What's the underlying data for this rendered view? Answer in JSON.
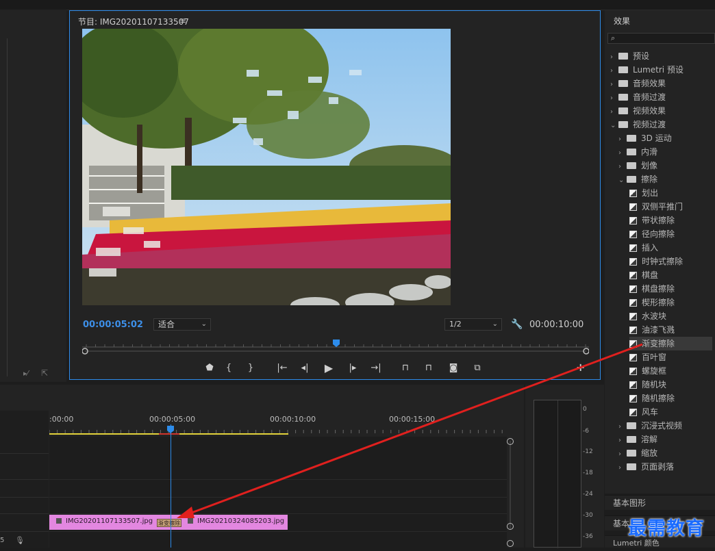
{
  "program_monitor": {
    "title": "节目: IMG20201107133507",
    "menu_icon": "≡",
    "timecode_current": "00:00:05:02",
    "fit_label": "适合",
    "resolution_label": "1/2",
    "timecode_duration": "00:00:10:00"
  },
  "transport": {
    "buttons": [
      "marker-icon",
      "mark-in-icon",
      "mark-out-icon",
      "go-to-in-icon",
      "step-back-icon",
      "play-icon",
      "step-forward-icon",
      "go-to-out-icon",
      "lift-icon",
      "extract-icon",
      "camera-icon",
      "compare-icon",
      "add-icon"
    ]
  },
  "effects": {
    "title": "效果",
    "tree": [
      {
        "label": "预设",
        "type": "folder",
        "level": 0,
        "arrow": "›"
      },
      {
        "label": "Lumetri 预设",
        "type": "folder",
        "level": 0,
        "arrow": "›"
      },
      {
        "label": "音频效果",
        "type": "folder",
        "level": 0,
        "arrow": "›"
      },
      {
        "label": "音频过渡",
        "type": "folder",
        "level": 0,
        "arrow": "›"
      },
      {
        "label": "视频效果",
        "type": "folder",
        "level": 0,
        "arrow": "›"
      },
      {
        "label": "视频过渡",
        "type": "folder",
        "level": 0,
        "arrow": "⌄"
      },
      {
        "label": "3D 运动",
        "type": "folder",
        "level": 1,
        "arrow": "›"
      },
      {
        "label": "内滑",
        "type": "folder",
        "level": 1,
        "arrow": "›"
      },
      {
        "label": "划像",
        "type": "folder",
        "level": 1,
        "arrow": "›"
      },
      {
        "label": "擦除",
        "type": "folder",
        "level": 1,
        "arrow": "⌄"
      },
      {
        "label": "划出",
        "type": "effect",
        "level": 2
      },
      {
        "label": "双侧平推门",
        "type": "effect",
        "level": 2
      },
      {
        "label": "带状擦除",
        "type": "effect",
        "level": 2
      },
      {
        "label": "径向擦除",
        "type": "effect",
        "level": 2
      },
      {
        "label": "插入",
        "type": "effect",
        "level": 2
      },
      {
        "label": "时钟式擦除",
        "type": "effect",
        "level": 2
      },
      {
        "label": "棋盘",
        "type": "effect",
        "level": 2
      },
      {
        "label": "棋盘擦除",
        "type": "effect",
        "level": 2
      },
      {
        "label": "楔形擦除",
        "type": "effect",
        "level": 2
      },
      {
        "label": "水波块",
        "type": "effect",
        "level": 2
      },
      {
        "label": "油漆飞溅",
        "type": "effect",
        "level": 2
      },
      {
        "label": "渐变擦除",
        "type": "effect",
        "level": 2,
        "selected": true
      },
      {
        "label": "百叶窗",
        "type": "effect",
        "level": 2
      },
      {
        "label": "螺旋框",
        "type": "effect",
        "level": 2
      },
      {
        "label": "随机块",
        "type": "effect",
        "level": 2
      },
      {
        "label": "随机擦除",
        "type": "effect",
        "level": 2
      },
      {
        "label": "风车",
        "type": "effect",
        "level": 2
      },
      {
        "label": "沉浸式视频",
        "type": "folder",
        "level": 1,
        "arrow": "›"
      },
      {
        "label": "溶解",
        "type": "folder",
        "level": 1,
        "arrow": "›"
      },
      {
        "label": "缩放",
        "type": "folder",
        "level": 1,
        "arrow": "›"
      },
      {
        "label": "页面剥落",
        "type": "folder",
        "level": 1,
        "arrow": "›"
      }
    ],
    "bottom_tabs": [
      "基本图形",
      "基本",
      "Lumetri 颜色"
    ]
  },
  "timeline": {
    "times": [
      ":00:00",
      "00:00:05:00",
      "00:00:10:00",
      "00:00:15:00"
    ],
    "clip_a": "IMG20201107133507.jpg",
    "clip_b": "IMG20210324085203.jpg",
    "transition_label": "渐变擦除",
    "left_label": "5"
  },
  "audio_meter": {
    "db_labels": [
      "0",
      "-6",
      "-12",
      "-18",
      "-24",
      "-30",
      "-36"
    ]
  },
  "watermark": "最需教育",
  "colors": {
    "accent": "#2d8ceb",
    "clip": "#e387e0",
    "arrow": "#e0201e"
  }
}
